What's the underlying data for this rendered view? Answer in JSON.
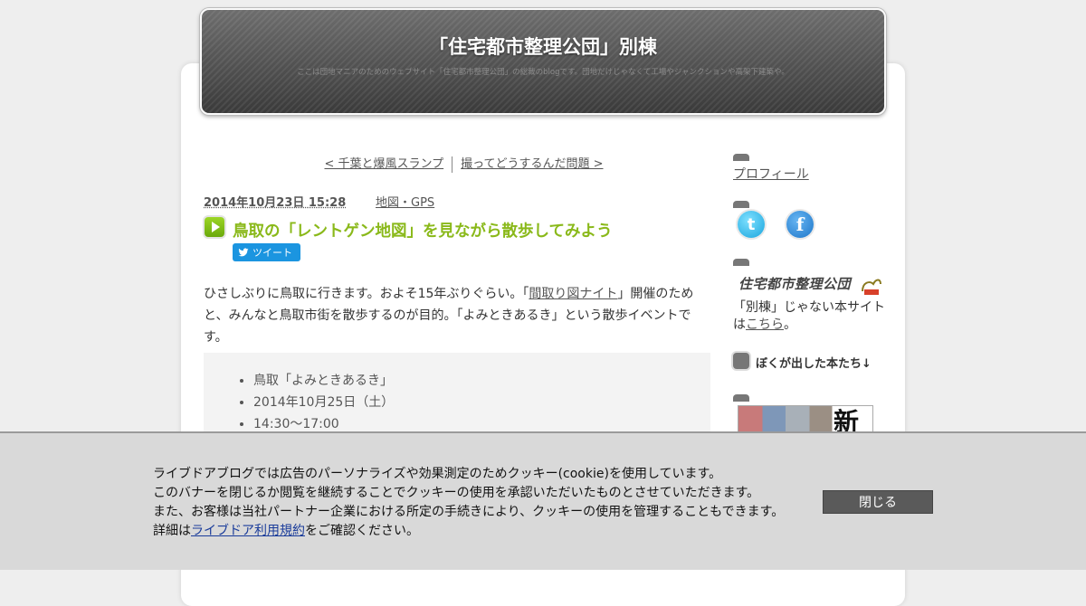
{
  "header": {
    "title": "「住宅都市整理公団」別棟",
    "subtitle": "ここは団地マニアのためのウェブサイト「住宅都市整理公団」の総裁のblogです。団地だけじゃなくて工場やジャンクションや高架下建築や。"
  },
  "pager": {
    "prev": "< 千葉と爆風スランプ",
    "next": "撮ってどうするんだ問題 >"
  },
  "post": {
    "date": "2014年10月23日 15:28",
    "category": "地図・GPS",
    "title": "鳥取の「レントゲン地図」を見ながら散歩してみよう",
    "tweet_label": "ツイート",
    "body_1": "ひさしぶりに鳥取に行きます。およそ15年ぶりぐらい。「",
    "body_link": "間取り図ナイト",
    "body_2": "」開催のためと、みんなと鳥取市街を散歩するのが目的。「よみときあるき」という散歩イベントです。",
    "list": [
      "鳥取「よみときあるき」",
      "2014年10月25日（土）",
      "14:30～17:00"
    ]
  },
  "sidebar": {
    "profile_link": "プロフィール",
    "logo_text": "住宅都市整理公団",
    "site_text_1": "「別棟」じゃない本サイトは",
    "site_link": "こちら",
    "site_text_2": "。",
    "books_heading": "ぼくが出した本たち↓",
    "book_cover_char": "新"
  },
  "icons": {
    "twitter_glyph": "t",
    "facebook_glyph": "f"
  },
  "cookie": {
    "line1": "ライブドアブログでは広告のパーソナライズや効果測定のためクッキー(cookie)を使用しています。",
    "line2": "このバナーを閉じるか閲覧を継続することでクッキーの使用を承認いただいたものとさせていただきます。",
    "line3": "また、お客様は当社パートナー企業における所定の手続きにより、クッキーの使用を管理することもできます。",
    "line4_pre": "詳細は",
    "line4_link": "ライブドア利用規約",
    "line4_post": "をご確認ください。",
    "close_label": "閉じる"
  },
  "colors": {
    "title_green": "#8ab91a",
    "tweet_blue": "#1b95e0",
    "banner_bg": "#d9d9d9"
  }
}
